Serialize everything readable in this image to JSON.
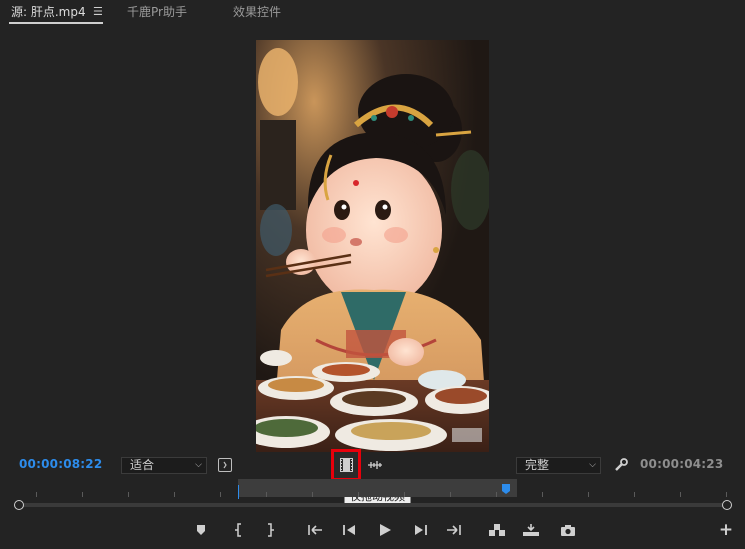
{
  "tabs": [
    {
      "label": "源: 肝点.mp4",
      "active": true
    },
    {
      "label": "千鹿Pr助手",
      "active": false
    },
    {
      "label": "效果控件",
      "active": false
    }
  ],
  "menu_icon": "hamburger-menu-icon",
  "current_timecode": "00:00:08:22",
  "fit_dropdown": "适合",
  "quality_dropdown": "完整",
  "duration_timecode": "00:00:04:23",
  "tooltip": "仅拖动视频",
  "playhead_fraction": 0.31,
  "colors": {
    "accent": "#2d8ceb",
    "highlight": "#e8000b",
    "background": "#232323"
  },
  "transport": [
    "add-marker-icon",
    "mark-in-icon",
    "mark-out-icon",
    "go-to-in-icon",
    "step-back-icon",
    "play-icon",
    "step-forward-icon",
    "go-to-out-icon",
    "insert-icon",
    "overwrite-icon",
    "export-frame-icon"
  ],
  "add_button": "+"
}
